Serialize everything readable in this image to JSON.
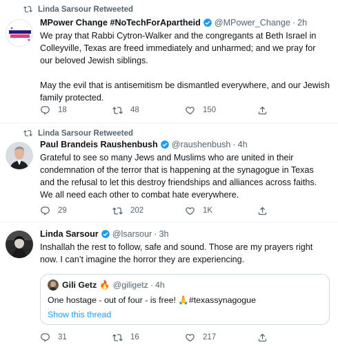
{
  "accent_color": "#1d9bf0",
  "tweets": [
    {
      "retweet_label": "Linda Sarsour Retweeted",
      "name": "MPower Change #NoTechForApartheid",
      "handle": "@MPower_Change",
      "time": "2h",
      "paragraphs": [
        "We pray that Rabbi Cytron-Walker and the congregants at Beth Israel in Colleyville, Texas are freed immediately and unharmed; and we pray for our beloved Jewish siblings.",
        "May the evil that is antisemitism be dismantled everywhere, and our Jewish family protected."
      ],
      "avatar_text": "MPOWER CHANGE",
      "replies": "18",
      "retweets": "48",
      "likes": "150"
    },
    {
      "retweet_label": "Linda Sarsour Retweeted",
      "name": "Paul Brandeis Raushenbush",
      "handle": "@raushenbush",
      "time": "4h",
      "paragraphs": [
        "Grateful to see so many Jews and Muslims who are united in their condemnation of the terror that is happening at the synagogue in Texas and the refusal to let this destroy friendships and alliances across faiths.  We all need each other to combat hate everywhere."
      ],
      "replies": "29",
      "retweets": "202",
      "likes": "1K"
    },
    {
      "name": "Linda Sarsour",
      "handle": "@lsarsour",
      "time": "3h",
      "paragraphs": [
        "Inshallah the rest to follow, safe and sound. Those are my prayers right now. I can’t imagine the horror they are experiencing."
      ],
      "quote": {
        "name": "Gili Getz",
        "emoji": "🔥",
        "handle": "@giligetz",
        "time": "4h",
        "text": "One hostage - out of four -  is free! 🙏#texassynagogue",
        "link": "Show this thread"
      },
      "replies": "31",
      "retweets": "16",
      "likes": "217"
    }
  ]
}
